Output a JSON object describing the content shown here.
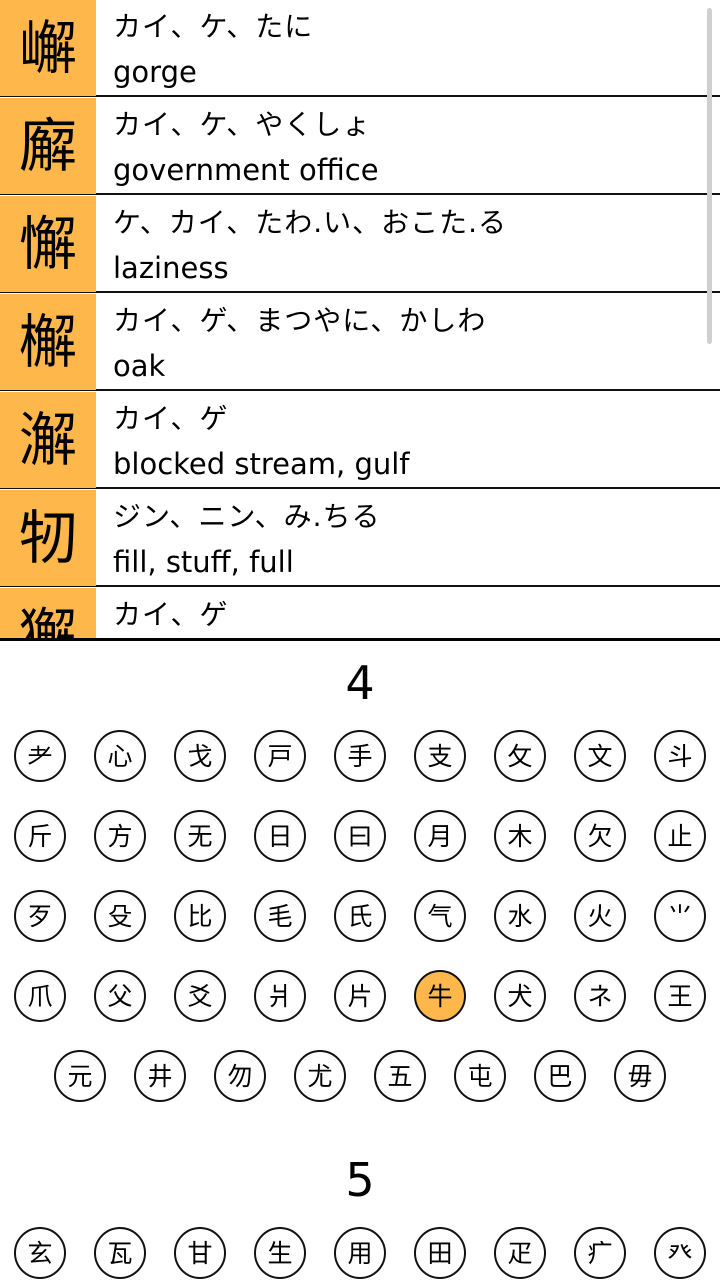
{
  "kanji_list": [
    {
      "kanji": "嶰",
      "reading": "カイ、ケ、たに",
      "meaning": "gorge"
    },
    {
      "kanji": "廨",
      "reading": "カイ、ケ、やくしょ",
      "meaning": "government office"
    },
    {
      "kanji": "懈",
      "reading": "ケ、カイ、たわ.い、おこた.る",
      "meaning": "laziness"
    },
    {
      "kanji": "檞",
      "reading": "カイ、ゲ、まつやに、かしわ",
      "meaning": "oak"
    },
    {
      "kanji": "澥",
      "reading": "カイ、ゲ",
      "meaning": "blocked stream, gulf"
    },
    {
      "kanji": "牣",
      "reading": "ジン、ニン、み.ちる",
      "meaning": "fill, stuff, full"
    },
    {
      "kanji": "獬",
      "reading": "カイ、ゲ",
      "meaning": ""
    }
  ],
  "stroke_groups": [
    {
      "title": "4",
      "rows": [
        [
          "⺹",
          "心",
          "戈",
          "戸",
          "手",
          "支",
          "攵",
          "文",
          "斗"
        ],
        [
          "斤",
          "方",
          "无",
          "日",
          "曰",
          "月",
          "木",
          "欠",
          "止"
        ],
        [
          "歹",
          "殳",
          "比",
          "毛",
          "氏",
          "气",
          "水",
          "火",
          "⺌"
        ],
        [
          "爪",
          "父",
          "爻",
          "爿",
          "片",
          "牛",
          "犬",
          "ネ",
          "王"
        ],
        [
          "元",
          "井",
          "勿",
          "尤",
          "五",
          "屯",
          "巴",
          "毋"
        ]
      ],
      "selected": "牛"
    },
    {
      "title": "5",
      "rows": [
        [
          "玄",
          "瓦",
          "甘",
          "生",
          "用",
          "田",
          "疋",
          "疒",
          "癶"
        ]
      ]
    }
  ],
  "colors": {
    "accent": "#fdb74a",
    "text": "#000000",
    "background": "#ffffff"
  }
}
